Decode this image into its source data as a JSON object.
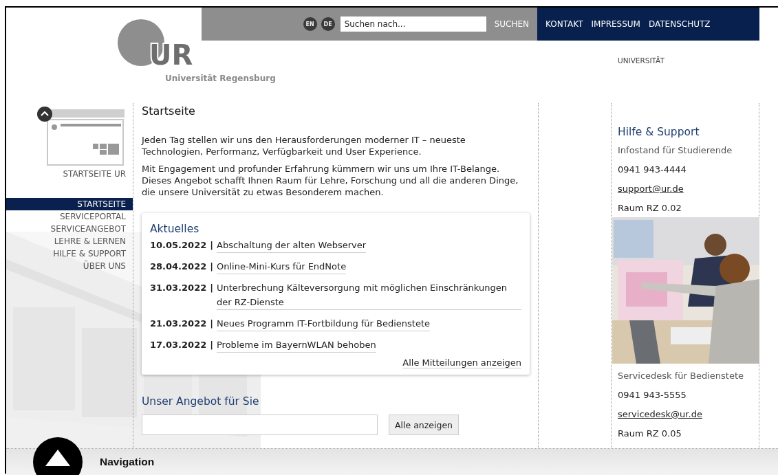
{
  "header": {
    "logo": {
      "letters": "UR",
      "subtitle": "Universität Regensburg"
    },
    "languages": [
      {
        "label": "EN"
      },
      {
        "label": "DE"
      }
    ],
    "search": {
      "placeholder": "Suchen nach...",
      "button": "SUCHEN"
    },
    "top_links": [
      "KONTAKT",
      "IMPRESSUM",
      "DATENSCHUTZ"
    ],
    "sub_nav": [
      "UNIVERSITÄT"
    ]
  },
  "sidebar": {
    "home_link": "STARTSEITE UR",
    "items": [
      {
        "label": "STARTSEITE",
        "selected": true
      },
      {
        "label": "SERVICEPORTAL",
        "selected": false
      },
      {
        "label": "SERVICEANGEBOT",
        "selected": false
      },
      {
        "label": "LEHRE & LERNEN",
        "selected": false
      },
      {
        "label": "HILFE & SUPPORT",
        "selected": false
      },
      {
        "label": "ÜBER UNS",
        "selected": false
      }
    ]
  },
  "main": {
    "title": "Startseite",
    "paragraphs": [
      "Jeden Tag stellen wir uns den Herausforderungen moderner IT – neueste Technologien, Performanz, Verfügbarkeit und User Experience.",
      "Mit Engagement und profunder Erfahrung kümmern wir uns um Ihre IT-Belange. Dieses Angebot schafft Ihnen Raum für Lehre, Forschung und all die anderen Dinge, die unsere Universität zu etwas Besonderem machen."
    ],
    "news": {
      "title": "Aktuelles",
      "items": [
        {
          "date": "10.05.2022",
          "separator": "|",
          "title": "Abschaltung der alten Webserver"
        },
        {
          "date": "28.04.2022",
          "separator": "|",
          "title": "Online-Mini-Kurs für EndNote"
        },
        {
          "date": "31.03.2022",
          "separator": "|",
          "title": "Unterbrechung Kälteversorgung mit möglichen Einschränkungen der RZ-Dienste"
        },
        {
          "date": "21.03.2022",
          "separator": "|",
          "title": "Neues Programm IT-Fortbildung für Bedienstete"
        },
        {
          "date": "17.03.2022",
          "separator": "|",
          "title": "Probleme im BayernWLAN behoben"
        }
      ],
      "more_link": "Alle Mitteilungen anzeigen"
    },
    "offers": {
      "title": "Unser Angebot für Sie",
      "button": "Alle anzeigen"
    }
  },
  "support": {
    "title": "Hilfe & Support",
    "contacts": [
      {
        "name": "Infostand für Studierende",
        "phone": "0941 943-4444",
        "email": "support@ur.de",
        "room": "Raum RZ 0.02"
      },
      {
        "name": "Servicedesk für Bedienstete",
        "phone": "0941 943-5555",
        "email": "servicedesk@ur.de",
        "room": "Raum RZ 0.05"
      }
    ]
  },
  "bottom_bar": {
    "label": "Navigation"
  }
}
